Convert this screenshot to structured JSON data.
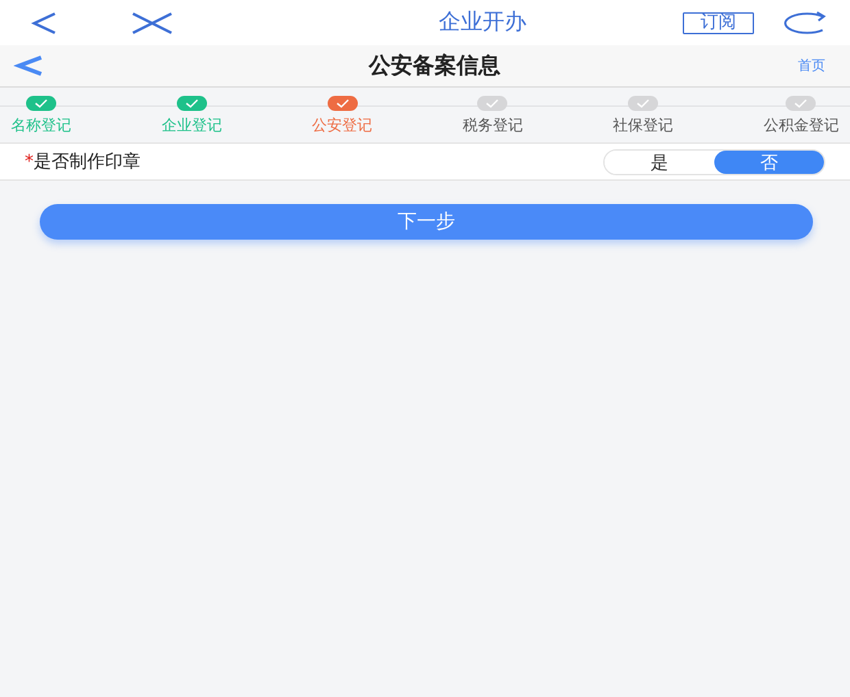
{
  "top_bar": {
    "title": "企业开办",
    "subscribe": "订阅"
  },
  "nav_bar": {
    "title": "公安备案信息",
    "home": "首页"
  },
  "steps": [
    {
      "label": "名称登记",
      "kind": "done"
    },
    {
      "label": "企业登记",
      "kind": "done"
    },
    {
      "label": "公安登记",
      "kind": "current"
    },
    {
      "label": "税务登记",
      "kind": "pending"
    },
    {
      "label": "社保登记",
      "kind": "pending"
    },
    {
      "label": "公积金登记",
      "kind": "pending"
    }
  ],
  "form": {
    "required_mark": "*",
    "label": "是否制作印章",
    "options": [
      {
        "label": "是",
        "selected": false
      },
      {
        "label": "否",
        "selected": true
      }
    ]
  },
  "next_button": "下一步"
}
